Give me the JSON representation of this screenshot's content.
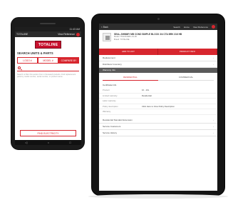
{
  "phone": {
    "status_time": "11:43 AM",
    "toolbar_label": "TOTALINE",
    "toolbar_action": "View Reference",
    "logo_text": "TOTALINE",
    "heading": "SEARCH UNITS & PARTS",
    "tabs": [
      {
        "label": "LOGO #"
      },
      {
        "label": "MODEL #"
      },
      {
        "label": "COMPARE BY"
      }
    ],
    "hint_text": "Search or filter this section from 1 thousand products. Find replacement parts by model number, serial number, or product name.",
    "bottom_button": "FIND ELECTRICITY",
    "nav_icons": [
      "back-icon",
      "home-icon",
      "recents-icon"
    ]
  },
  "tablet": {
    "top_left": "< Back",
    "top_items": [
      "Search",
      "Home",
      "View Reference"
    ],
    "product": {
      "title": "SEAL-SHIMMY MB COND SIMPLE BLOCK 3/4 CTA BRK 316 HB",
      "line1": "Model: TM1234ABC-01-00",
      "line2": "Brand: TOTALINE"
    },
    "actions": [
      "ADD TO LIST",
      "PRODUCT INFO"
    ],
    "rows": [
      "Replacement",
      "Distributor Inventory"
    ],
    "section": "Warranty Info",
    "seg_tabs": [
      "RESIDENTIAL",
      "COMMERCIAL"
    ],
    "sublabel": "Certificate Info",
    "kv": [
      {
        "k": "Product",
        "v": "10 - 10L"
      },
      {
        "k": "Limited warranty",
        "v": "Residential"
      },
      {
        "k": "Labor warranty",
        "v": ""
      },
      {
        "k": "Policy description",
        "v": "Click Here to View Policy Description"
      },
      {
        "k": "Warranty",
        "v": ""
      }
    ],
    "more_rows": [
      "Residential Standard Extension",
      "Service Customers",
      "Service History"
    ]
  }
}
